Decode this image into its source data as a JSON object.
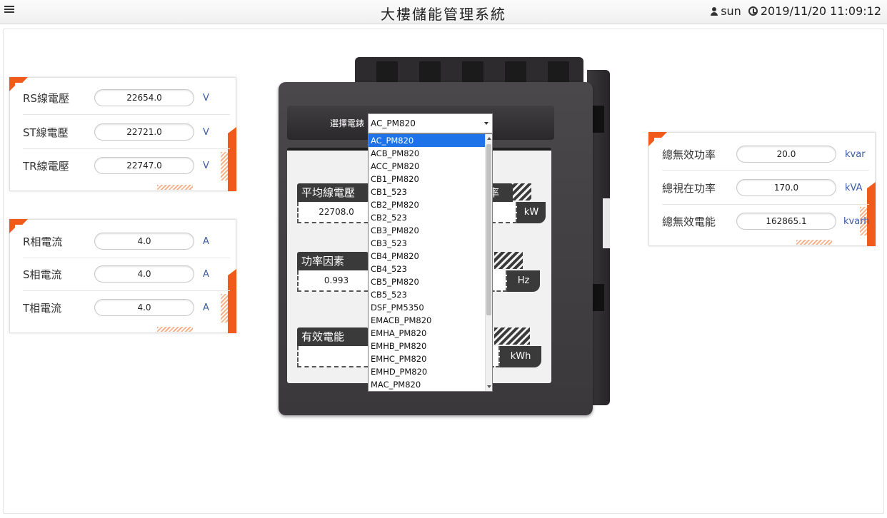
{
  "header": {
    "title": "大樓儲能管理系統",
    "user": "sun",
    "datetime": "2019/11/20 11:09:12"
  },
  "voltage_panel": {
    "rows": [
      {
        "label": "RS線電壓",
        "value": "22654.0",
        "unit": "V"
      },
      {
        "label": "ST線電壓",
        "value": "22721.0",
        "unit": "V"
      },
      {
        "label": "TR線電壓",
        "value": "22747.0",
        "unit": "V"
      }
    ]
  },
  "current_panel": {
    "rows": [
      {
        "label": "R相電流",
        "value": "4.0",
        "unit": "A"
      },
      {
        "label": "S相電流",
        "value": "4.0",
        "unit": "A"
      },
      {
        "label": "T相電流",
        "value": "4.0",
        "unit": "A"
      }
    ]
  },
  "power_panel": {
    "rows": [
      {
        "label": "總無效功率",
        "value": "20.0",
        "unit": "kvar"
      },
      {
        "label": "總視在功率",
        "value": "170.0",
        "unit": "kVA"
      },
      {
        "label": "總無效電能",
        "value": "162865.1",
        "unit": "kvarh"
      }
    ]
  },
  "meter": {
    "select_label": "選擇電錶",
    "selected_value": "AC_PM820",
    "options": [
      "AC_PM820",
      "ACB_PM820",
      "ACC_PM820",
      "CB1_PM820",
      "CB1_523",
      "CB2_PM820",
      "CB2_523",
      "CB3_PM820",
      "CB3_523",
      "CB4_PM820",
      "CB4_523",
      "CB5_PM820",
      "CB5_523",
      "DSF_PM5350",
      "EMACB_PM820",
      "EMHA_PM820",
      "EMHB_PM820",
      "EMHC_PM820",
      "EMHD_PM820",
      "MAC_PM820"
    ],
    "readouts": {
      "avg_line_voltage": {
        "label": "平均線電壓",
        "value": "22708.0"
      },
      "power_label_tail": "率",
      "power_unit": "kW",
      "power_factor": {
        "label": "功率因素",
        "value": "0.993"
      },
      "freq_unit": "Hz",
      "active_energy": {
        "label": "有效電能",
        "value": ""
      },
      "energy_unit": "kWh"
    }
  }
}
